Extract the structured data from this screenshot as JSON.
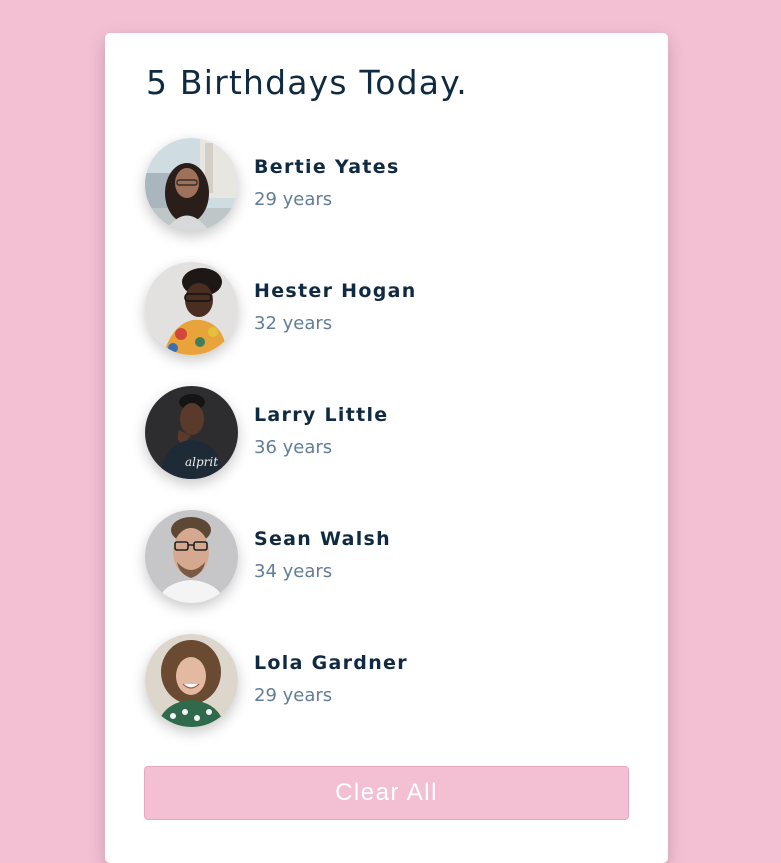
{
  "title": "5 Birthdays Today.",
  "people": [
    {
      "name": "Bertie Yates",
      "age": "29 years",
      "avatar": "avatar-photo"
    },
    {
      "name": "Hester Hogan",
      "age": "32 years",
      "avatar": "avatar-photo"
    },
    {
      "name": "Larry Little",
      "age": "36 years",
      "avatar": "avatar-photo"
    },
    {
      "name": "Sean Walsh",
      "age": "34 years",
      "avatar": "avatar-photo"
    },
    {
      "name": "Lola Gardner",
      "age": "29 years",
      "avatar": "avatar-photo"
    }
  ],
  "clear_button": {
    "label": "Clear All"
  },
  "colors": {
    "background": "#f3c0d3",
    "card": "#ffffff",
    "name_text": "#102a42",
    "age_text": "#617d98",
    "button_text": "#ffffff"
  }
}
